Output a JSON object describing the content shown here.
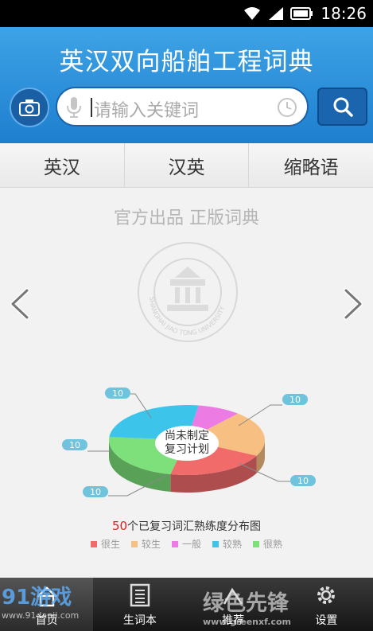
{
  "status": {
    "time": "18:26"
  },
  "header": {
    "title": "英汉双向船舶工程词典"
  },
  "search": {
    "placeholder": "请输入关键词"
  },
  "tabs": [
    {
      "label": "英汉"
    },
    {
      "label": "汉英"
    },
    {
      "label": "缩略语"
    }
  ],
  "banner": {
    "slogan": "官方出品 正版词典",
    "seal_text": "SHANGHAI JIAO TONG UNIVERSITY"
  },
  "chart_data": {
    "type": "pie",
    "title_count": "50",
    "title_rest": "个已复习词汇熟练度分布图",
    "center_label": [
      "尚未制定",
      "复习计划"
    ],
    "series": [
      {
        "name": "很生",
        "value": 10,
        "color": "#f26b6b"
      },
      {
        "name": "较生",
        "value": 10,
        "color": "#f7c082"
      },
      {
        "name": "一般",
        "value": 10,
        "color": "#ec7be4"
      },
      {
        "name": "较熟",
        "value": 10,
        "color": "#3cc4ea"
      },
      {
        "name": "很熟",
        "value": 10,
        "color": "#7de07a"
      }
    ],
    "callouts": [
      "10",
      "10",
      "10",
      "10",
      "10"
    ]
  },
  "bottom_nav": [
    {
      "label": "首页",
      "icon": "home-icon"
    },
    {
      "label": "生词本",
      "icon": "notebook-icon"
    },
    {
      "label": "推荐",
      "icon": "recommend-icon"
    },
    {
      "label": "设置",
      "icon": "gear-icon"
    }
  ],
  "watermarks": {
    "left": "91游戏",
    "left_sub": "www.91danji.com",
    "right": "绿色先锋",
    "right_sub": "www.greenxf.com"
  }
}
